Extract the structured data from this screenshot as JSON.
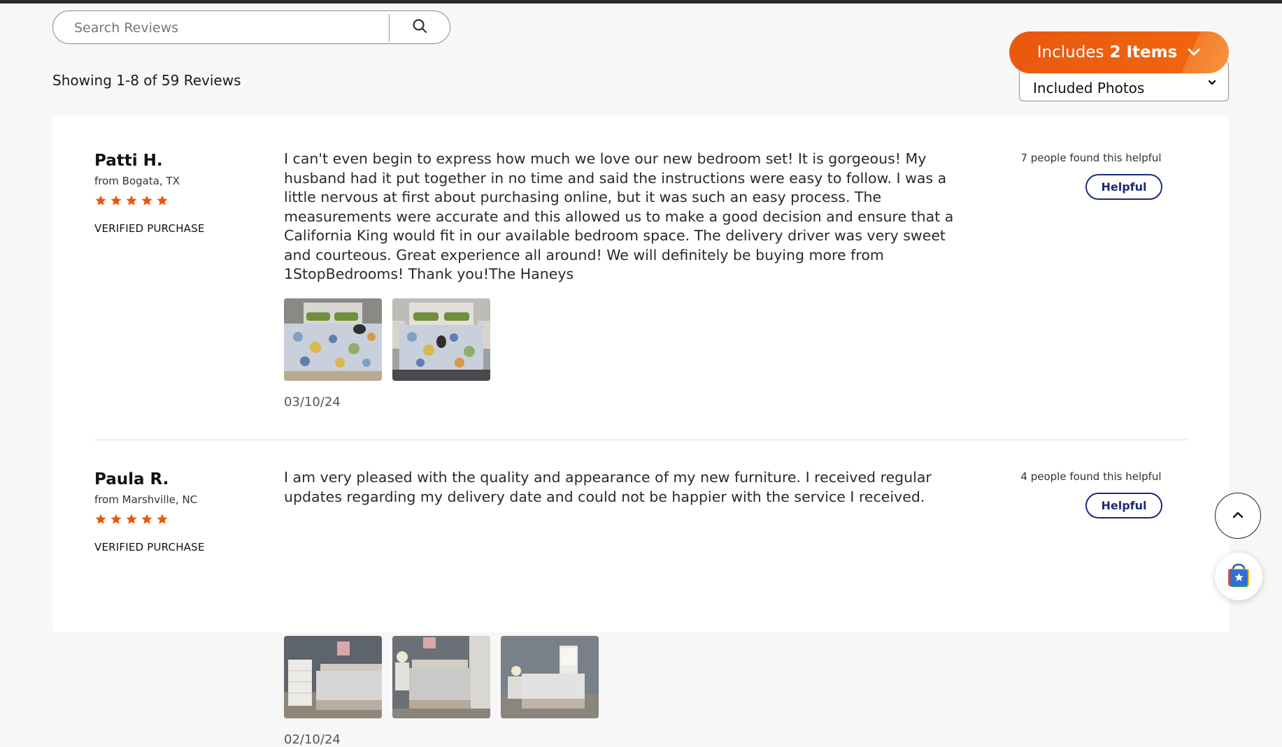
{
  "search": {
    "placeholder": "Search Reviews",
    "icon": "search-icon"
  },
  "summary": {
    "showing_text": "Showing 1-8 of 59 Reviews"
  },
  "sort": {
    "selected": "Included Photos",
    "icon": "chevron-down-icon"
  },
  "includes": {
    "prefix": "Includes",
    "count_label": "2 Items",
    "icon": "chevron-down-icon",
    "color": "#e8580f"
  },
  "reviews": [
    {
      "name": "Patti H.",
      "location": "from Bogata, TX",
      "rating": 5,
      "rating_max": 5,
      "verified": "VERIFIED PURCHASE",
      "text": "I can't even begin to express how much we love our new bedroom set! It is gorgeous! My husband had it put together in no time and said the instructions were easy to follow. I was a little nervous at first about purchasing online, but it was such an easy process. The measurements were accurate and this allowed us to make a good decision and ensure that a California King would fit in our available bedroom space. The delivery driver was very sweet and courteous. Great experience all around! We will definitely be buying more from 1StopBedrooms! Thank you!The Haneys",
      "date": "03/10/24",
      "helpful_count": "7 people found this helpful",
      "helpful_label": "Helpful"
    },
    {
      "name": "Paula R.",
      "location": "from Marshville, NC",
      "rating": 5,
      "rating_max": 5,
      "verified": "VERIFIED PURCHASE",
      "text": "I am very pleased with the quality and appearance of my new furniture. I received regular updates regarding my delivery date and could not be happier with the service I received.",
      "date": "02/10/24",
      "helpful_count": "4 people found this helpful",
      "helpful_label": "Helpful"
    }
  ],
  "colors": {
    "star": "#e8560f",
    "helpful_border": "#1c2b7a",
    "accent": "#e8580f"
  },
  "floating": {
    "scroll_top_icon": "chevron-up-icon",
    "shop_icon": "shopping-bag-star-icon"
  }
}
